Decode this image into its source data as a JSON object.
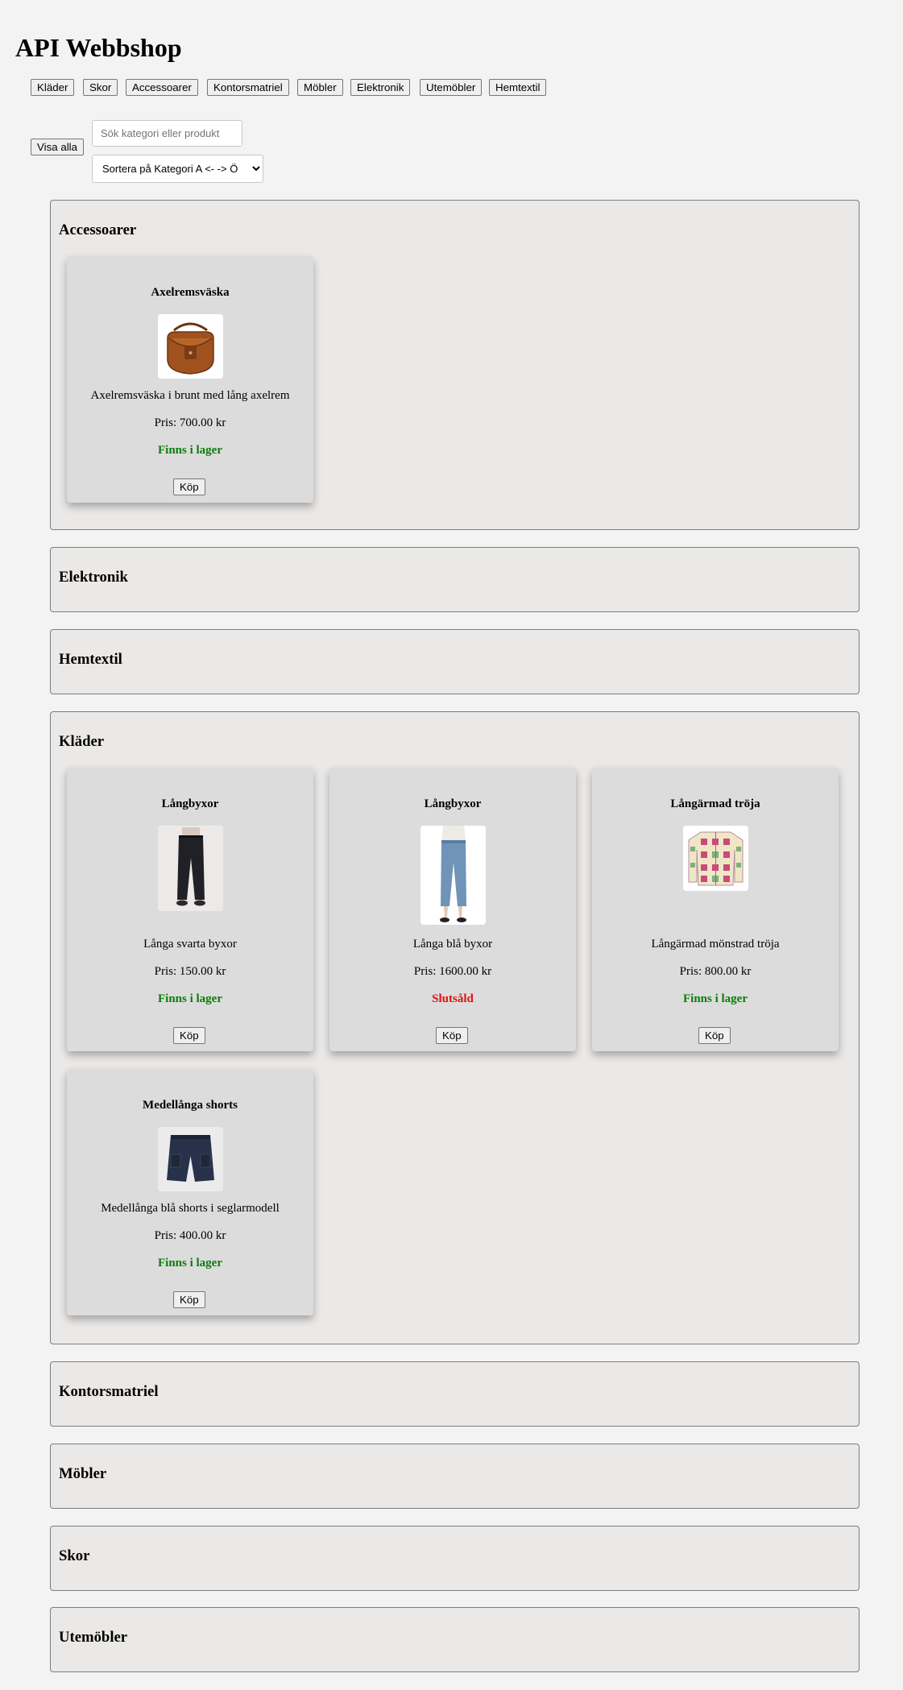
{
  "site": {
    "title": "API Webbshop"
  },
  "category_nav": [
    "Kläder",
    "Skor",
    "Accessoarer",
    "Kontorsmatriel",
    "Möbler",
    "Elektronik",
    "Utemöbler",
    "Hemtextil"
  ],
  "controls": {
    "show_all_label": "Visa alla",
    "search_placeholder": "Sök kategori eller produkt",
    "sort_selected": "Sortera på Kategori A <- -> Ö"
  },
  "sections": [
    {
      "title": "Accessoarer",
      "products": [
        {
          "name": "Axelremsväska",
          "description": "Axelremsväska i brunt med lång axelrem",
          "price": "Pris: 700.00 kr",
          "stock": "Finns i lager",
          "in_stock": true,
          "buy_label": "Köp",
          "image": "shoulder-bag"
        }
      ]
    },
    {
      "title": "Elektronik",
      "products": []
    },
    {
      "title": "Hemtextil",
      "products": []
    },
    {
      "title": "Kläder",
      "products": [
        {
          "name": "Långbyxor",
          "description": "Långa svarta byxor",
          "price": "Pris: 150.00 kr",
          "stock": "Finns i lager",
          "in_stock": true,
          "buy_label": "Köp",
          "image": "black-trousers"
        },
        {
          "name": "Långbyxor",
          "description": "Långa blå byxor",
          "price": "Pris: 1600.00 kr",
          "stock": "Slutsåld",
          "in_stock": false,
          "buy_label": "Köp",
          "image": "blue-jeans"
        },
        {
          "name": "Långärmad tröja",
          "description": "Långärmad mönstrad tröja",
          "price": "Pris: 800.00 kr",
          "stock": "Finns i lager",
          "in_stock": true,
          "buy_label": "Köp",
          "image": "patterned-sweater"
        },
        {
          "name": "Medellånga shorts",
          "description": "Medellånga blå shorts i seglarmodell",
          "price": "Pris: 400.00 kr",
          "stock": "Finns i lager",
          "in_stock": true,
          "buy_label": "Köp",
          "image": "navy-shorts"
        }
      ]
    },
    {
      "title": "Kontorsmatriel",
      "products": []
    },
    {
      "title": "Möbler",
      "products": []
    },
    {
      "title": "Skor",
      "products": []
    },
    {
      "title": "Utemöbler",
      "products": []
    }
  ],
  "colors": {
    "in_stock": "#0a7d0a",
    "sold_out": "#e01010",
    "page_bg": "#f3f3f3",
    "section_bg": "#ebe9e7",
    "card_bg": "#dddcdc"
  }
}
